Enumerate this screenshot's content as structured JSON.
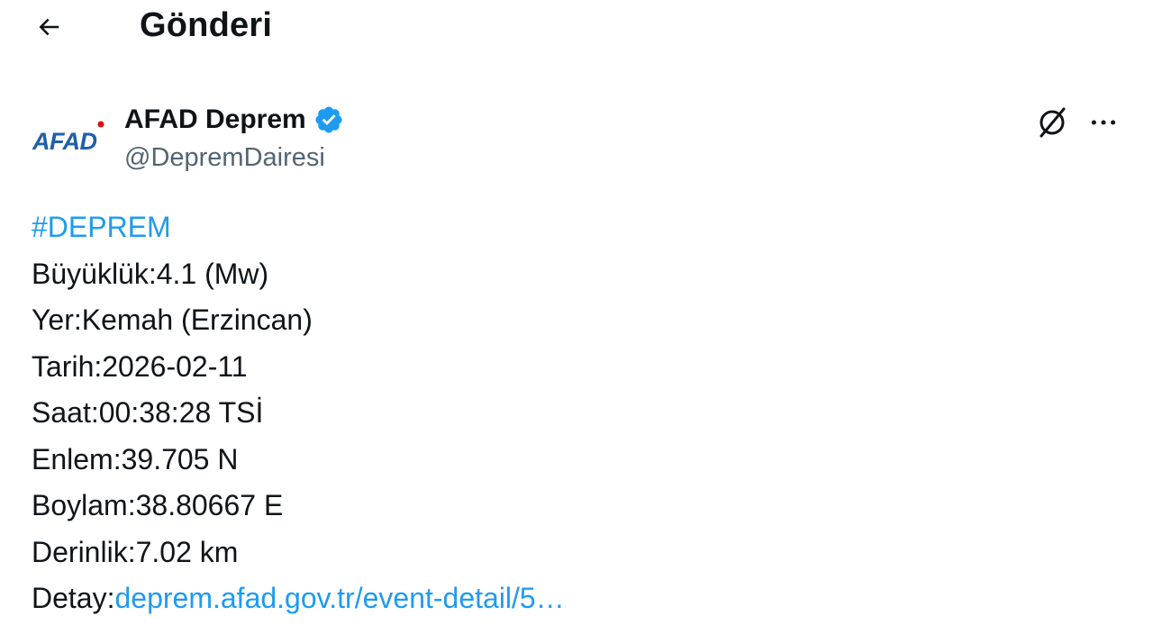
{
  "header": {
    "title": "Gönderi",
    "back_icon": "arrow-left-icon"
  },
  "author": {
    "avatar_text": "AFAD",
    "name": "AFAD Deprem",
    "handle": "@DepremDairesi",
    "verified_icon": "verified-badge-icon"
  },
  "actions": {
    "grok_icon": "grok-icon",
    "more_icon": "more-horizontal-icon"
  },
  "tweet": {
    "hashtag": "#DEPREM",
    "magnitude": "Büyüklük:4.1 (Mw)",
    "location": "Yer:Kemah (Erzincan)",
    "date": "Tarih:2026-02-11",
    "time": "Saat:00:38:28 TSİ",
    "latitude": "Enlem:39.705 N",
    "longitude": "Boylam:38.80667 E",
    "depth": "Derinlik:7.02 km",
    "detail_label": "Detay:",
    "detail_link": "deprem.afad.gov.tr/event-detail/5…"
  },
  "colors": {
    "link": "#1d9bf0",
    "text": "#0f1419",
    "muted": "#536471",
    "brand_blue": "#1f5fa8",
    "brand_red": "#e30613"
  }
}
